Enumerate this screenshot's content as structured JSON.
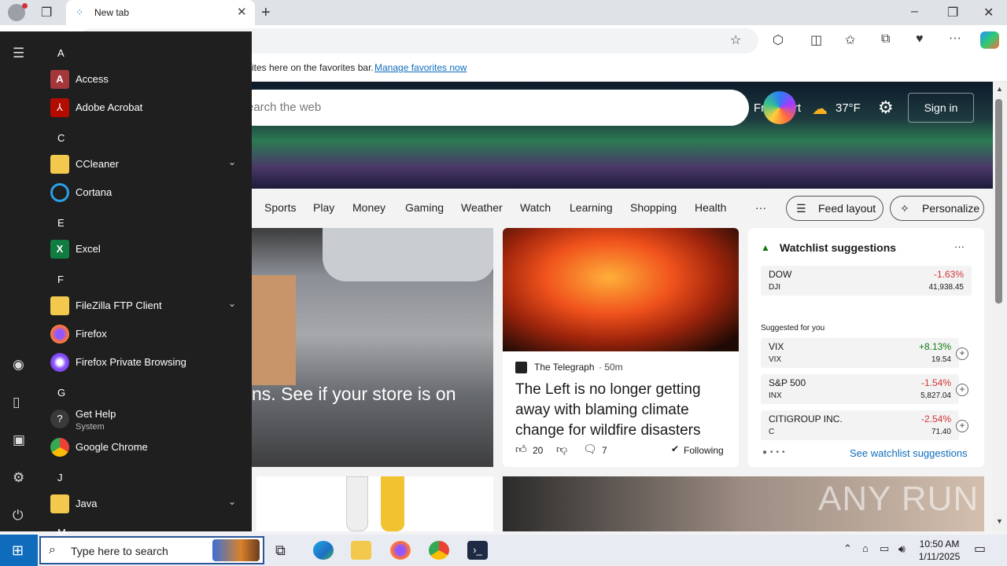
{
  "browser": {
    "tab_title": "New tab",
    "favorites_text": "ites here on the favorites bar.",
    "favorites_link": "Manage favorites now"
  },
  "page": {
    "search_placeholder": "earch the web",
    "location": "Frankfurt",
    "temperature": "37°F",
    "sign_in": "Sign in",
    "nav": [
      "Sports",
      "Play",
      "Money",
      "Gaming",
      "Weather",
      "Watch",
      "Learning",
      "Shopping",
      "Health",
      "···"
    ],
    "feed_layout": "Feed layout",
    "personalize": "Personalize",
    "card1_headline": "ns. See if your store is on",
    "card2": {
      "source": "The Telegraph",
      "time": "· 50m",
      "headline": "The Left is no longer getting away with blaming climate change for wildfire disasters",
      "likes": "20",
      "comments": "7",
      "following": "Following"
    },
    "watchlist": {
      "title": "Watchlist suggestions",
      "more": "···",
      "suggested_label": "Suggested for you",
      "see_more": "See watchlist suggestions",
      "stocks": [
        {
          "name": "DOW",
          "symbol": "DJI",
          "change": "-1.63%",
          "value": "41,938.45",
          "dir": "down"
        },
        {
          "name": "VIX",
          "symbol": "VIX",
          "change": "+8.13%",
          "value": "19.54",
          "dir": "up"
        },
        {
          "name": "S&P 500",
          "symbol": "INX",
          "change": "-1.54%",
          "value": "5,827.04",
          "dir": "down"
        },
        {
          "name": "CITIGROUP INC.",
          "symbol": "C",
          "change": "-2.54%",
          "value": "71.40",
          "dir": "down"
        }
      ]
    },
    "watermark": "ANY RUN"
  },
  "start_menu": {
    "letters": [
      "A",
      "C",
      "E",
      "F",
      "G",
      "J",
      "M"
    ],
    "apps": [
      {
        "label": "Access",
        "sub": "",
        "expand": false,
        "icon": "access-icon",
        "color": "#a4373a"
      },
      {
        "label": "Adobe Acrobat",
        "sub": "",
        "expand": false,
        "icon": "acrobat-icon",
        "color": "#b30b00"
      },
      {
        "label": "CCleaner",
        "sub": "",
        "expand": true,
        "icon": "folder-icon",
        "color": "#f2c94c"
      },
      {
        "label": "Cortana",
        "sub": "",
        "expand": false,
        "icon": "cortana-icon",
        "color": "#1f1f1f"
      },
      {
        "label": "Excel",
        "sub": "",
        "expand": false,
        "icon": "excel-icon",
        "color": "#107c41"
      },
      {
        "label": "FileZilla FTP Client",
        "sub": "",
        "expand": true,
        "icon": "folder-icon",
        "color": "#f2c94c"
      },
      {
        "label": "Firefox",
        "sub": "",
        "expand": false,
        "icon": "firefox-icon",
        "color": "#ff7139"
      },
      {
        "label": "Firefox Private Browsing",
        "sub": "",
        "expand": false,
        "icon": "firefox-private-icon",
        "color": "#6a2fc1"
      },
      {
        "label": "Get Help",
        "sub": "System",
        "expand": false,
        "icon": "get-help-icon",
        "color": "#3a3a3a"
      },
      {
        "label": "Google Chrome",
        "sub": "",
        "expand": false,
        "icon": "chrome-icon",
        "color": "#ea4335"
      },
      {
        "label": "Java",
        "sub": "",
        "expand": true,
        "icon": "folder-icon",
        "color": "#f2c94c"
      }
    ]
  },
  "taskbar": {
    "search_placeholder": "Type here to search",
    "time": "10:50 AM",
    "date": "1/11/2025"
  }
}
